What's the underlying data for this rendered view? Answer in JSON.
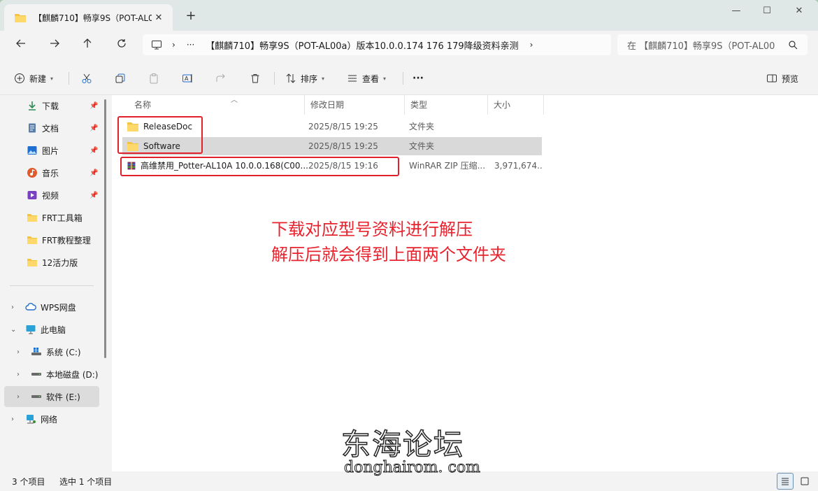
{
  "tab": {
    "title": "【麒麟710】畅享9S（POT-AL0"
  },
  "window_controls": {
    "minimize": "—",
    "maximize": "☐",
    "close": "✕"
  },
  "address": {
    "ellipsis": "···",
    "path": "【麒麟710】畅享9S（POT-AL00a）版本10.0.0.174  176  179降级资料亲测",
    "search_placeholder": "在 【麒麟710】畅享9S（POT-AL00"
  },
  "toolbar": {
    "new_label": "新建",
    "sort_label": "排序",
    "view_label": "查看",
    "more_label": "···",
    "preview_label": "预览"
  },
  "sidebar": {
    "quick": [
      {
        "label": "下载",
        "icon": "download-icon",
        "color": "#2e8b57"
      },
      {
        "label": "文档",
        "icon": "document-icon",
        "color": "#5b7fa8"
      },
      {
        "label": "图片",
        "icon": "picture-icon",
        "color": "#1e6fcf"
      },
      {
        "label": "音乐",
        "icon": "music-icon",
        "color": "#e05a2b"
      },
      {
        "label": "视频",
        "icon": "video-icon",
        "color": "#7b3fc4"
      },
      {
        "label": "FRT工具箱",
        "icon": "folder-icon",
        "color": "#f5c342"
      },
      {
        "label": "FRT教程整理",
        "icon": "folder-icon",
        "color": "#f5c342"
      },
      {
        "label": "12活力版",
        "icon": "folder-icon",
        "color": "#f5c342"
      }
    ],
    "tree": [
      {
        "label": "WPS网盘",
        "icon": "cloud-icon"
      },
      {
        "label": "此电脑",
        "icon": "computer-icon"
      },
      {
        "label": "系统 (C:)",
        "icon": "windows-drive-icon"
      },
      {
        "label": "本地磁盘 (D:)",
        "icon": "drive-icon"
      },
      {
        "label": "软件 (E:)",
        "icon": "drive-icon"
      },
      {
        "label": "网络",
        "icon": "network-icon"
      }
    ]
  },
  "columns": {
    "name": "名称",
    "date": "修改日期",
    "type": "类型",
    "size": "大小"
  },
  "files": [
    {
      "name": "ReleaseDoc",
      "date": "2025/8/15 19:25",
      "type": "文件夹",
      "size": "",
      "icon": "folder-icon"
    },
    {
      "name": "Software",
      "date": "2025/8/15 19:25",
      "type": "文件夹",
      "size": "",
      "icon": "folder-icon"
    },
    {
      "name": "高维禁用_Potter-AL10A 10.0.0.168(C00...",
      "date": "2025/8/15 19:16",
      "type": "WinRAR ZIP 压缩...",
      "size": "3,971,674...",
      "icon": "winrar-icon"
    }
  ],
  "annotation": {
    "line1": "下载对应型号资料进行解压",
    "line2": "解压后就会得到上面两个文件夹"
  },
  "status": {
    "count": "3 个项目",
    "selection": "选中 1 个项目"
  },
  "watermark": {
    "cn": "东海论坛",
    "en": "donghairom. com"
  },
  "colors": {
    "accent_red": "#e0202a",
    "folder_yellow": "#f5c342"
  }
}
